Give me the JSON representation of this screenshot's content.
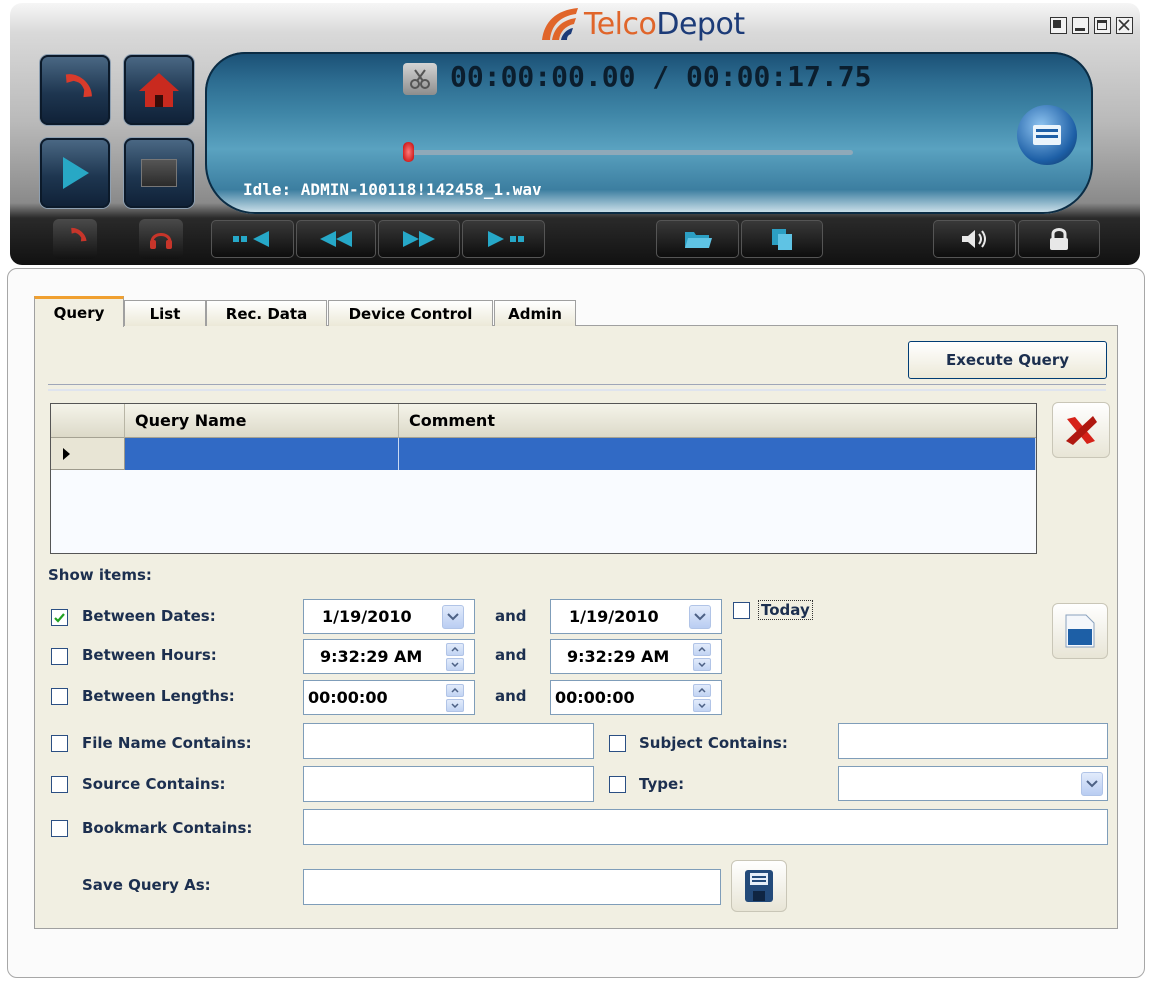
{
  "app": {
    "brand_part1": "Telco",
    "brand_part2": "Depot",
    "accent": "#e0652a",
    "brand_color": "#1c3b78"
  },
  "window_controls": [
    "restore-icon",
    "minimize-icon",
    "maximize-icon",
    "close-icon"
  ],
  "player": {
    "time_current": "00:00:00.00",
    "time_separator": " / ",
    "time_total": "00:00:17.75",
    "status": "Idle: ADMIN-100118!142458_1.wav",
    "progress_fraction": 0.0,
    "left_buttons": [
      "phone-icon",
      "home-icon",
      "play-icon",
      "stop-icon"
    ],
    "toolbar_icons": [
      "headset-phone-icon",
      "headphones-icon",
      "skip-start-icon",
      "rewind-icon",
      "fast-forward-icon",
      "skip-end-icon",
      "folder-open-icon",
      "copy-icon",
      "volume-icon",
      "lock-icon"
    ]
  },
  "tabs": [
    {
      "label": "Query",
      "active": true
    },
    {
      "label": "List",
      "active": false
    },
    {
      "label": "Rec. Data",
      "active": false
    },
    {
      "label": "Device Control",
      "active": false
    },
    {
      "label": "Admin",
      "active": false
    }
  ],
  "query": {
    "execute_label": "Execute Query",
    "grid": {
      "columns": [
        "Query Name",
        "Comment"
      ],
      "rows": [
        [
          "",
          ""
        ]
      ]
    },
    "show_items_label": "Show items:",
    "between_dates": {
      "label": "Between Dates:",
      "checked": true,
      "from": "1/19/2010",
      "and": "and",
      "to": "1/19/2010"
    },
    "today": {
      "label": "Today",
      "checked": false
    },
    "between_hours": {
      "label": "Between Hours:",
      "checked": false,
      "from": "9:32:29 AM",
      "and": "and",
      "to": "9:32:29 AM"
    },
    "between_lengths": {
      "label": "Between Lengths:",
      "checked": false,
      "from": "00:00:00",
      "and": "and",
      "to": "00:00:00"
    },
    "file_name": {
      "label": "File Name Contains:",
      "checked": false,
      "value": ""
    },
    "subject": {
      "label": "Subject Contains:",
      "checked": false,
      "value": ""
    },
    "source": {
      "label": "Source Contains:",
      "checked": false,
      "value": ""
    },
    "type": {
      "label": "Type:",
      "checked": false,
      "value": ""
    },
    "bookmark": {
      "label": "Bookmark Contains:",
      "checked": false,
      "value": ""
    },
    "save_as": {
      "label": "Save Query As:",
      "value": ""
    }
  }
}
